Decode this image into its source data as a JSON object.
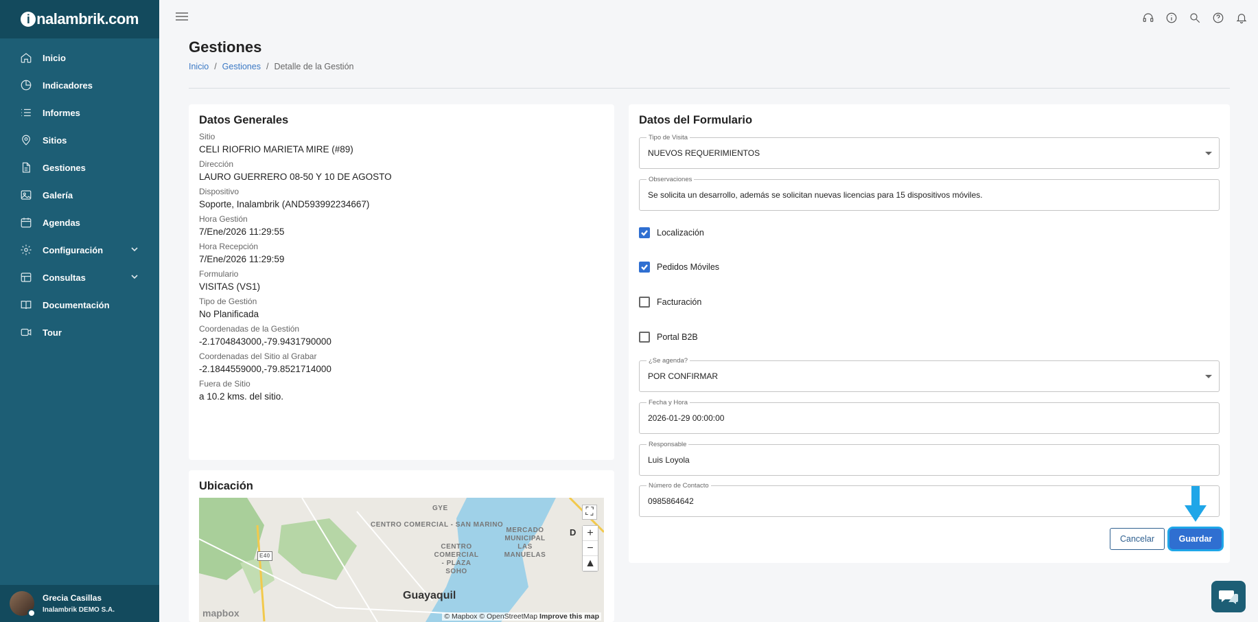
{
  "brand": {
    "logo_badge": "i",
    "logo_text": "nalambrik.com"
  },
  "sidebar": {
    "items": [
      {
        "label": "Inicio",
        "icon": "home-icon"
      },
      {
        "label": "Indicadores",
        "icon": "pie-chart-icon"
      },
      {
        "label": "Informes",
        "icon": "list-icon"
      },
      {
        "label": "Sitios",
        "icon": "map-pin-icon"
      },
      {
        "label": "Gestiones",
        "icon": "document-icon"
      },
      {
        "label": "Galería",
        "icon": "image-icon"
      },
      {
        "label": "Agendas",
        "icon": "calendar-icon"
      },
      {
        "label": "Configuración",
        "icon": "gear-icon",
        "expandable": true
      },
      {
        "label": "Consultas",
        "icon": "table-icon",
        "expandable": true
      },
      {
        "label": "Documentación",
        "icon": "book-icon"
      },
      {
        "label": "Tour",
        "icon": "video-icon"
      }
    ],
    "user": {
      "name": "Grecia Casillas",
      "company": "Inalambrik DEMO S.A."
    }
  },
  "topbar": {
    "icons": [
      "headset-icon",
      "info-icon",
      "search-icon",
      "help-icon",
      "bell-icon"
    ]
  },
  "header": {
    "title": "Gestiones",
    "breadcrumb": {
      "home": "Inicio",
      "section": "Gestiones",
      "current": "Detalle de la Gestión",
      "separator": "/"
    }
  },
  "general": {
    "title": "Datos Generales",
    "fields": [
      {
        "label": "Sitio",
        "value": "CELI RIOFRIO MARIETA MIRE (#89)"
      },
      {
        "label": "Dirección",
        "value": "LAURO GUERRERO 08-50 Y 10 DE AGOSTO"
      },
      {
        "label": "Dispositivo",
        "value": "Soporte, Inalambrik (AND593992234667)"
      },
      {
        "label": "Hora Gestión",
        "value": "7/Ene/2026 11:29:55"
      },
      {
        "label": "Hora Recepción",
        "value": "7/Ene/2026 11:29:59"
      },
      {
        "label": "Formulario",
        "value": "VISITAS (VS1)"
      },
      {
        "label": "Tipo de Gestión",
        "value": "No Planificada"
      },
      {
        "label": "Coordenadas de la Gestión",
        "value": "-2.1704843000,-79.9431790000"
      },
      {
        "label": "Coordenadas del Sitio al Grabar",
        "value": "-2.1844559000,-79.8521714000"
      },
      {
        "label": "Fuera de Sitio",
        "value": "a 10.2 kms. del sitio."
      }
    ]
  },
  "location": {
    "title": "Ubicación",
    "map": {
      "city": "Guayaquil",
      "labels": [
        "CENTRO COMERCIAL - SAN MARINO",
        "CENTRO COMERCIAL - PLAZA SOHO",
        "MERCADO MUNICIPAL LAS MANUELAS",
        "GYE",
        "E40",
        "D"
      ],
      "attribution": "© Mapbox © OpenStreetMap",
      "improve": "Improve this map",
      "logo": "mapbox",
      "zoom_in": "+",
      "zoom_out": "−"
    }
  },
  "form": {
    "title": "Datos del Formulario",
    "tipo_visita": {
      "label": "Tipo de Visita",
      "value": "NUEVOS REQUERIMIENTOS"
    },
    "observaciones": {
      "label": "Observaciones",
      "value": "Se solicita un desarrollo, además se solicitan nuevas licencias para 15 dispositivos móviles."
    },
    "checkboxes": [
      {
        "label": "Localización",
        "checked": true
      },
      {
        "label": "Pedidos Móviles",
        "checked": true
      },
      {
        "label": "Facturación",
        "checked": false
      },
      {
        "label": "Portal B2B",
        "checked": false
      }
    ],
    "agenda": {
      "label": "¿Se agenda?",
      "value": "POR CONFIRMAR"
    },
    "fecha": {
      "label": "Fecha y Hora",
      "value": "2026-01-29 00:00:00"
    },
    "responsable": {
      "label": "Responsable",
      "value": "Luis Loyola"
    },
    "contacto": {
      "label": "Número de Contacto",
      "value": "0985864642"
    },
    "cancel_label": "Cancelar",
    "save_label": "Guardar"
  },
  "colors": {
    "sidebar": "#1d5e75",
    "sidebar_dark": "#134a5d",
    "primary": "#2f6fd1",
    "link": "#3a78c4",
    "highlight": "#1fa6e8"
  }
}
